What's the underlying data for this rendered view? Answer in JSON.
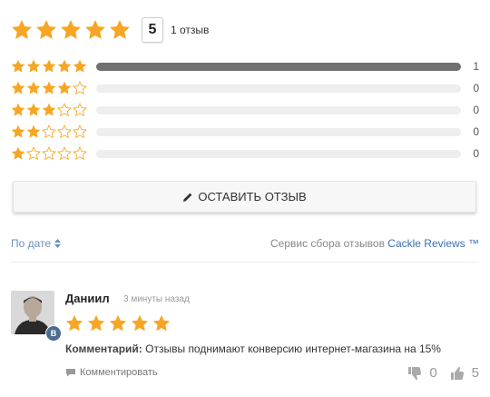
{
  "summary": {
    "rating": "5",
    "review_count_text": "1 отзыв",
    "star_color": "#f6a623"
  },
  "distribution": [
    {
      "stars": 5,
      "fraction": 1.0,
      "count": "1"
    },
    {
      "stars": 4,
      "fraction": 0.0,
      "count": "0"
    },
    {
      "stars": 3,
      "fraction": 0.0,
      "count": "0"
    },
    {
      "stars": 2,
      "fraction": 0.0,
      "count": "0"
    },
    {
      "stars": 1,
      "fraction": 0.0,
      "count": "0"
    }
  ],
  "write_button": {
    "label": "ОСТАВИТЬ ОТЗЫВ",
    "icon": "pencil-icon"
  },
  "sort": {
    "label": "По дате",
    "icon": "sort-icon"
  },
  "service": {
    "prefix": "Сервис сбора отзывов ",
    "link": "Cackle Reviews ™"
  },
  "review": {
    "author": "Даниил",
    "time": "3 минуты назад",
    "badge": "B",
    "rating": 5,
    "comment_label": "Комментарий:",
    "comment_text": " Отзывы поднимают конверсию интернет-магазина на 15%",
    "reply_label": "Комментировать",
    "dislikes": "0",
    "likes": "5"
  }
}
